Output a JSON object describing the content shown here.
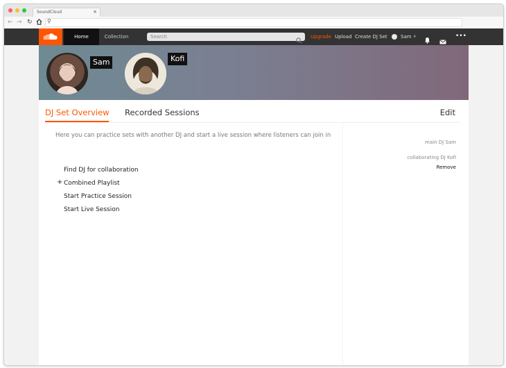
{
  "browser": {
    "tab_title": "SoundCloud",
    "tab_close": "×"
  },
  "header": {
    "nav": {
      "home": "Home",
      "collection": "Collection"
    },
    "search": {
      "placeholder": "Search",
      "value": ""
    },
    "links": {
      "upgrade": "Upgrade",
      "upload": "Upload",
      "create_dj_set": "Create DJ Set"
    },
    "user": {
      "name": "Sam"
    },
    "more": "•••",
    "colors": {
      "brand": "#ff5500",
      "header_bg": "#333333"
    }
  },
  "banner": {
    "djs": [
      {
        "name": "Sam"
      },
      {
        "name": "Kofi"
      }
    ]
  },
  "tabs": {
    "overview": "DJ Set Overview",
    "recorded": "Recorded Sessions",
    "edit": "Edit"
  },
  "main": {
    "description": "Here you can practice sets with another DJ and start a live session where listeners can join in",
    "items": [
      {
        "label": "Find DJ for collaboration"
      },
      {
        "label": "Combined Playlist",
        "prefix": "+"
      },
      {
        "label": "Start Practice Session"
      },
      {
        "label": "Start Live Session"
      }
    ]
  },
  "sidebar": {
    "main_dj": "main DJ Sam",
    "collaborating_dj": "collaborating DJ Kofi",
    "remove": "Remove"
  },
  "icons": {
    "soundcloud_logo": "soundcloud-logo-icon",
    "search": "search-icon",
    "bell": "bell-icon",
    "mail": "mail-icon",
    "more": "more-icon",
    "back": "back-arrow-icon",
    "forward": "forward-arrow-icon",
    "reload": "reload-icon",
    "home": "home-icon",
    "url_search": "search-icon"
  }
}
